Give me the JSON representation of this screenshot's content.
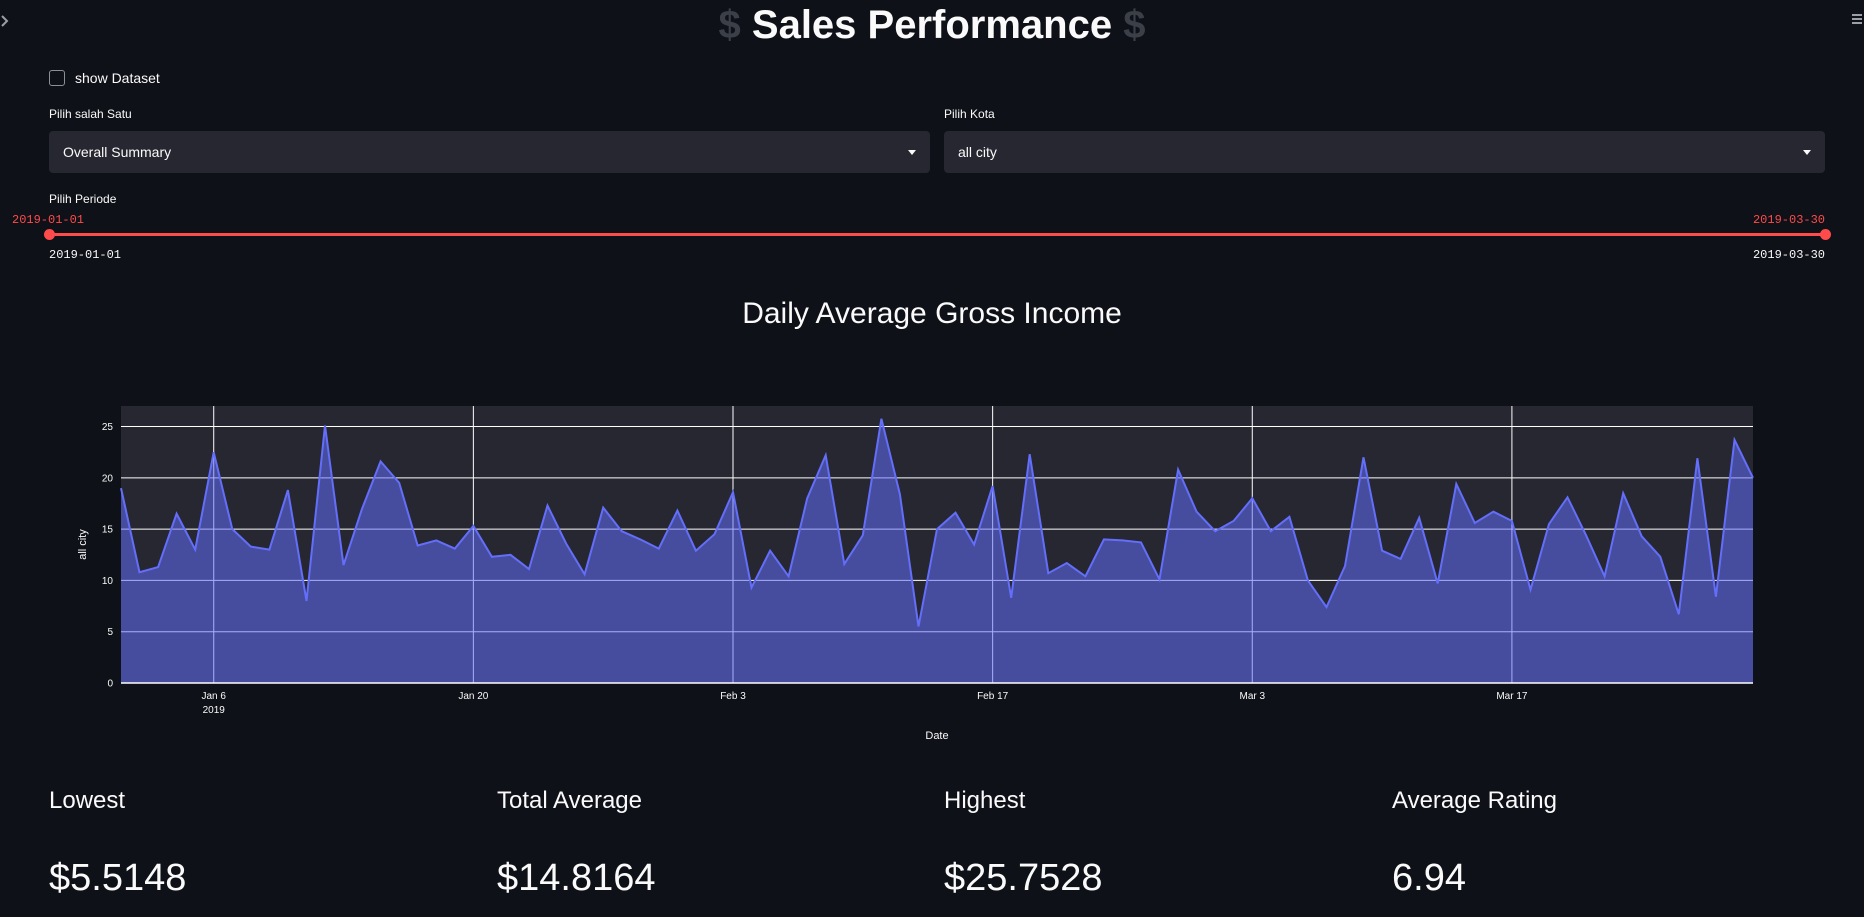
{
  "header": {
    "title": "Sales Performance",
    "decoration": "$"
  },
  "dataset_toggle": {
    "label": "show Dataset",
    "checked": false
  },
  "selectors": {
    "summary": {
      "label": "Pilih salah Satu",
      "value": "Overall Summary"
    },
    "city": {
      "label": "Pilih Kota",
      "value": "all city"
    }
  },
  "period": {
    "label": "Pilih Periode",
    "start": "2019-01-01",
    "end": "2019-03-30",
    "min_label": "2019-01-01",
    "max_label": "2019-03-30"
  },
  "chart": {
    "title": "Daily Average Gross Income"
  },
  "chart_data": {
    "type": "area",
    "title": "Daily Average Gross Income",
    "xlabel": "Date",
    "ylabel": "all city",
    "x_tick_labels": [
      "Jan 6",
      "Jan 20",
      "Feb 3",
      "Feb 17",
      "Mar 3",
      "Mar 17"
    ],
    "x_tick_sublabel": "2019",
    "y_ticks": [
      0,
      5,
      10,
      15,
      20,
      25
    ],
    "xlim": [
      "2019-01-01",
      "2019-03-30"
    ],
    "ylim": [
      0,
      27
    ],
    "series": [
      {
        "name": "all city",
        "color": "#636efa",
        "x": [
          "2019-01-01",
          "2019-01-02",
          "2019-01-03",
          "2019-01-04",
          "2019-01-05",
          "2019-01-06",
          "2019-01-07",
          "2019-01-08",
          "2019-01-09",
          "2019-01-10",
          "2019-01-11",
          "2019-01-12",
          "2019-01-13",
          "2019-01-14",
          "2019-01-15",
          "2019-01-16",
          "2019-01-17",
          "2019-01-18",
          "2019-01-19",
          "2019-01-20",
          "2019-01-21",
          "2019-01-22",
          "2019-01-23",
          "2019-01-24",
          "2019-01-25",
          "2019-01-26",
          "2019-01-27",
          "2019-01-28",
          "2019-01-29",
          "2019-01-30",
          "2019-01-31",
          "2019-02-01",
          "2019-02-02",
          "2019-02-03",
          "2019-02-04",
          "2019-02-05",
          "2019-02-06",
          "2019-02-07",
          "2019-02-08",
          "2019-02-09",
          "2019-02-10",
          "2019-02-11",
          "2019-02-12",
          "2019-02-13",
          "2019-02-14",
          "2019-02-15",
          "2019-02-16",
          "2019-02-17",
          "2019-02-18",
          "2019-02-19",
          "2019-02-20",
          "2019-02-21",
          "2019-02-22",
          "2019-02-23",
          "2019-02-24",
          "2019-02-25",
          "2019-02-26",
          "2019-02-27",
          "2019-02-28",
          "2019-03-01",
          "2019-03-02",
          "2019-03-03",
          "2019-03-04",
          "2019-03-05",
          "2019-03-06",
          "2019-03-07",
          "2019-03-08",
          "2019-03-09",
          "2019-03-10",
          "2019-03-11",
          "2019-03-12",
          "2019-03-13",
          "2019-03-14",
          "2019-03-15",
          "2019-03-16",
          "2019-03-17",
          "2019-03-18",
          "2019-03-19",
          "2019-03-20",
          "2019-03-21",
          "2019-03-22",
          "2019-03-23",
          "2019-03-24",
          "2019-03-25",
          "2019-03-26",
          "2019-03-27",
          "2019-03-28",
          "2019-03-29",
          "2019-03-30"
        ],
        "values": [
          19.0,
          10.8,
          11.3,
          16.5,
          13.0,
          22.5,
          15.0,
          13.3,
          13.0,
          18.8,
          8.0,
          25.1,
          11.5,
          17.0,
          21.6,
          19.5,
          13.4,
          13.9,
          13.1,
          15.3,
          12.3,
          12.5,
          11.1,
          17.3,
          13.6,
          10.6,
          17.1,
          14.8,
          14.0,
          13.1,
          16.8,
          12.9,
          14.5,
          18.6,
          9.3,
          12.9,
          10.4,
          18.0,
          22.2,
          11.6,
          14.4,
          25.75,
          18.4,
          5.51,
          15.0,
          16.6,
          13.5,
          19.2,
          8.3,
          22.3,
          10.7,
          11.7,
          10.4,
          14.0,
          13.9,
          13.7,
          10.1,
          20.8,
          16.7,
          14.8,
          15.8,
          18.0,
          14.8,
          16.2,
          10.0,
          7.4,
          11.4,
          22.0,
          12.9,
          12.1,
          16.1,
          9.7,
          19.4,
          15.6,
          16.7,
          15.8,
          9.1,
          15.5,
          18.1,
          14.4,
          10.4,
          18.5,
          14.3,
          12.3,
          6.7,
          21.9,
          8.4,
          23.7,
          20.0
        ]
      }
    ],
    "plot_bg": "#262730",
    "grid": true
  },
  "metrics": [
    {
      "label": "Lowest",
      "value": "$5.5148"
    },
    {
      "label": "Total Average",
      "value": "$14.8164"
    },
    {
      "label": "Highest",
      "value": "$25.7528"
    },
    {
      "label": "Average Rating",
      "value": "6.94"
    }
  ],
  "colors": {
    "accent": "#ff4b4b",
    "background": "#0e1117",
    "widget": "#262730",
    "series": "#636efa"
  }
}
